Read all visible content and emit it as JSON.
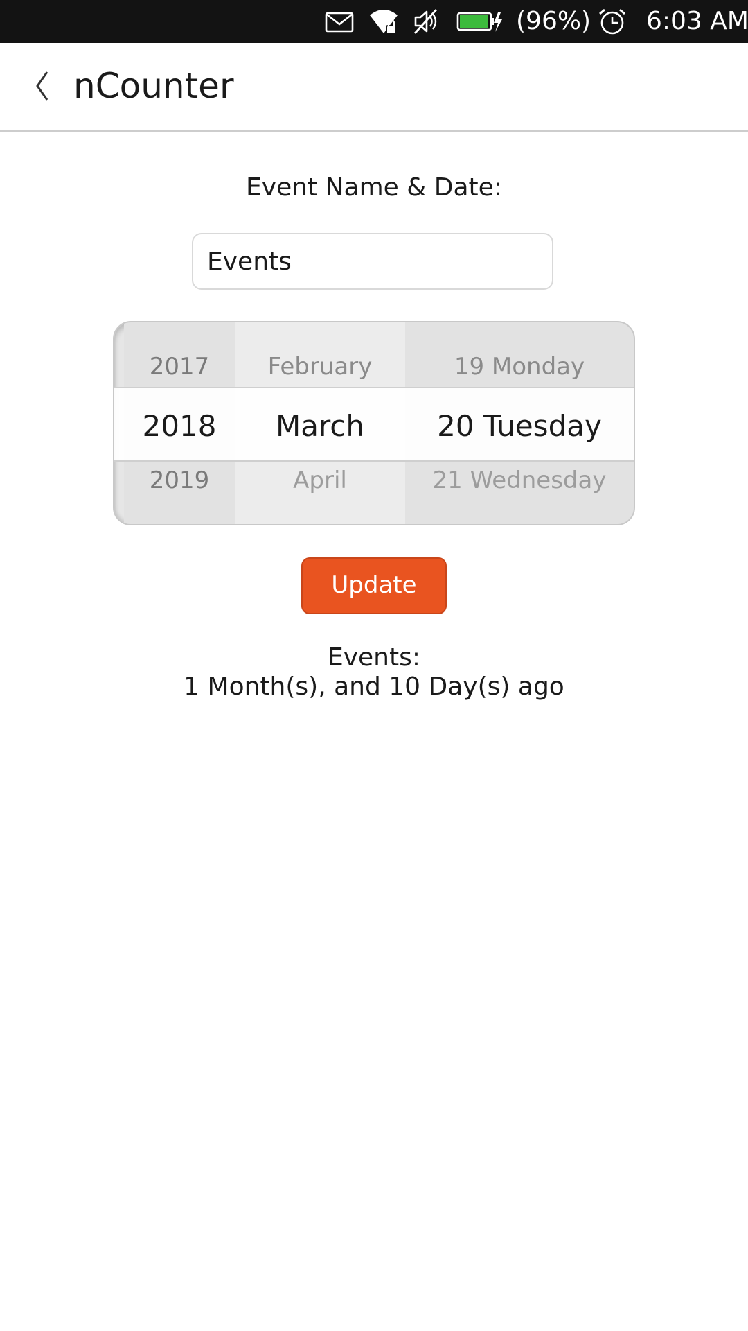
{
  "status_bar": {
    "battery_percent": "(96%)",
    "time": "6:03 AM",
    "icons": [
      "mail-icon",
      "wifi-locked-icon",
      "volume-muted-icon",
      "battery-charging-icon",
      "alarm-clock-icon"
    ],
    "battery_level": 0.96,
    "battery_color": "#3dbb3d"
  },
  "header": {
    "title": "nCounter",
    "back_icon": "chevron-left-icon"
  },
  "form": {
    "label": "Event Name & Date:",
    "name_value": "Events"
  },
  "date_picker": {
    "year": {
      "prev": "2017",
      "selected": "2018",
      "next": "2019"
    },
    "month": {
      "prev": "February",
      "selected": "March",
      "next": "April"
    },
    "day": {
      "prev": "19 Monday",
      "selected": "20 Tuesday",
      "next": "21 Wednesday"
    }
  },
  "update_button": {
    "label": "Update",
    "color": "#e95420"
  },
  "result": {
    "title": "Events:",
    "text": "1 Month(s), and 10 Day(s) ago"
  }
}
